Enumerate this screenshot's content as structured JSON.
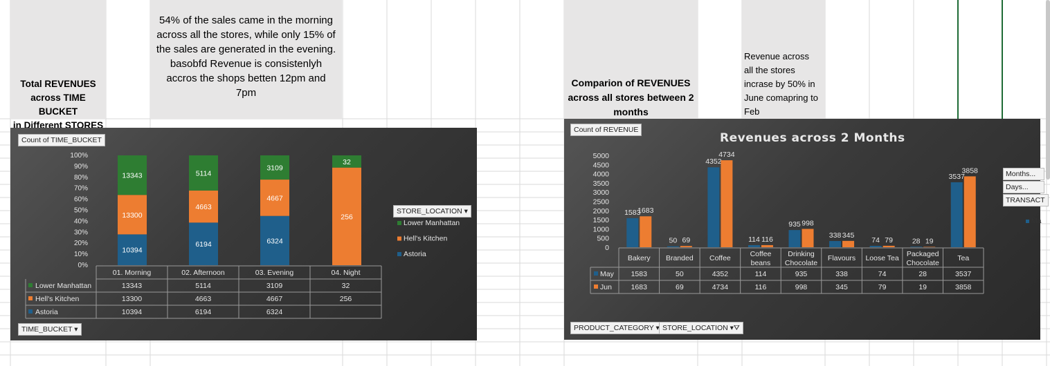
{
  "left_header": {
    "title": "Total REVENUES across TIME BUCKET in Different STORES",
    "title_lines": [
      "Total REVENUES",
      "across TIME BUCKET",
      "in Different STORES"
    ],
    "note_lines": [
      "54% of the sales came in the morning",
      "across all the stores, while only 15% of",
      "the sales are generated in the evening.",
      "basobfd Revenue is consistenlyh",
      "accros the shops betten 12pm and",
      "7pm"
    ]
  },
  "right_header": {
    "title_lines": [
      "Comparion of REVENUES",
      "across all stores between 2",
      "months"
    ],
    "note_lines": [
      "Revenue across",
      "all the stores",
      "incrase by 50% in",
      "June comapring to",
      "Feb"
    ]
  },
  "left_chart": {
    "value_button": "Count of TIME_BUCKET",
    "axis_button": "TIME_BUCKET",
    "legend_button": "STORE_LOCATION",
    "colors": {
      "Lower Manhattan": "#2e7d32",
      "Hell's Kitchen": "#ed7d31",
      "Astoria": "#1f5f8b"
    }
  },
  "right_chart": {
    "value_button": "Count of REVENUE",
    "title": "Revenues across 2 Months",
    "filter_buttons": [
      "PRODUCT_CATEGORY",
      "STORE_LOCATION"
    ],
    "side_buttons": [
      "Months...",
      "Days...",
      "TRANSACT"
    ],
    "side_legend_fragment": "Ma",
    "colors": {
      "May": "#1f5f8b",
      "Jun": "#ed7d31"
    }
  },
  "chart_data": [
    {
      "type": "bar",
      "stacked": "percent",
      "categories": [
        "01. Morning",
        "02. Afternoon",
        "03. Evening",
        "04. Night"
      ],
      "series": [
        {
          "name": "Lower Manhattan",
          "values": [
            13343,
            5114,
            3109,
            32
          ]
        },
        {
          "name": "Hell's Kitchen",
          "values": [
            13300,
            4663,
            4667,
            256
          ]
        },
        {
          "name": "Astoria",
          "values": [
            10394,
            6194,
            6324,
            null
          ]
        }
      ],
      "y_ticks": [
        "100%",
        "90%",
        "80%",
        "70%",
        "60%",
        "50%",
        "40%",
        "30%",
        "20%",
        "10%",
        "0%"
      ],
      "ylim": [
        0,
        100
      ],
      "legend": "right",
      "data_table": true
    },
    {
      "type": "bar",
      "title": "Revenues across 2 Months",
      "categories": [
        "Bakery",
        "Branded",
        "Coffee",
        "Coffee beans",
        "Drinking Chocolate",
        "Flavours",
        "Loose Tea",
        "Packaged Chocolate",
        "Tea"
      ],
      "series": [
        {
          "name": "May",
          "values": [
            1583,
            50,
            4352,
            114,
            935,
            338,
            74,
            28,
            3537
          ]
        },
        {
          "name": "Jun",
          "values": [
            1683,
            69,
            4734,
            116,
            998,
            345,
            79,
            19,
            3858
          ]
        }
      ],
      "y_ticks": [
        "5000",
        "4500",
        "4000",
        "3500",
        "3000",
        "2500",
        "2000",
        "1500",
        "1000",
        "500",
        "0"
      ],
      "ylim": [
        0,
        5000
      ],
      "data_table": true
    }
  ]
}
